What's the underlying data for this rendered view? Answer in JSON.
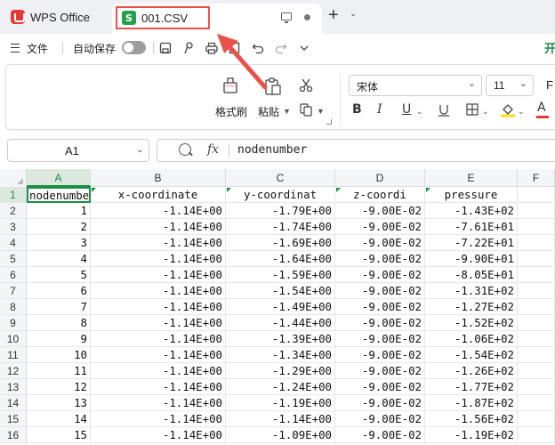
{
  "app": {
    "name": "WPS Office"
  },
  "tab": {
    "title": "001.CSV",
    "icon_letter": "S"
  },
  "toolbar": {
    "file_label": "文件",
    "autosave_label": "自动保存",
    "start_label": "开"
  },
  "ribbon": {
    "format_painter_label": "格式刷",
    "paste_label": "粘贴",
    "font_name": "宋体",
    "font_size": "11",
    "bold": "B",
    "italic": "I",
    "underline": "U",
    "font_color_letter": "A",
    "partial_letter": "F"
  },
  "formula_bar": {
    "cell_ref": "A1",
    "fx_label": "fx",
    "value": "nodenumber"
  },
  "colors": {
    "accent": "#1a8e45",
    "annotation": "#e9524a"
  },
  "grid": {
    "columns": [
      "A",
      "B",
      "C",
      "D",
      "E",
      "F"
    ],
    "header_row": {
      "row": "1",
      "cells": [
        "nodenumbe",
        "x-coordinate",
        "y-coordinat",
        "z-coordi",
        "pressure",
        ""
      ]
    },
    "rows": [
      {
        "row": "2",
        "cells": [
          "1",
          "-1.14E+00",
          "-1.79E+00",
          "-9.00E-02",
          "-1.43E+02",
          ""
        ]
      },
      {
        "row": "3",
        "cells": [
          "2",
          "-1.14E+00",
          "-1.74E+00",
          "-9.00E-02",
          "-7.61E+01",
          ""
        ]
      },
      {
        "row": "4",
        "cells": [
          "3",
          "-1.14E+00",
          "-1.69E+00",
          "-9.00E-02",
          "-7.22E+01",
          ""
        ]
      },
      {
        "row": "5",
        "cells": [
          "4",
          "-1.14E+00",
          "-1.64E+00",
          "-9.00E-02",
          "-9.90E+01",
          ""
        ]
      },
      {
        "row": "6",
        "cells": [
          "5",
          "-1.14E+00",
          "-1.59E+00",
          "-9.00E-02",
          "-8.05E+01",
          ""
        ]
      },
      {
        "row": "7",
        "cells": [
          "6",
          "-1.14E+00",
          "-1.54E+00",
          "-9.00E-02",
          "-1.31E+02",
          ""
        ]
      },
      {
        "row": "8",
        "cells": [
          "7",
          "-1.14E+00",
          "-1.49E+00",
          "-9.00E-02",
          "-1.27E+02",
          ""
        ]
      },
      {
        "row": "9",
        "cells": [
          "8",
          "-1.14E+00",
          "-1.44E+00",
          "-9.00E-02",
          "-1.52E+02",
          ""
        ]
      },
      {
        "row": "10",
        "cells": [
          "9",
          "-1.14E+00",
          "-1.39E+00",
          "-9.00E-02",
          "-1.06E+02",
          ""
        ]
      },
      {
        "row": "11",
        "cells": [
          "10",
          "-1.14E+00",
          "-1.34E+00",
          "-9.00E-02",
          "-1.54E+02",
          ""
        ]
      },
      {
        "row": "12",
        "cells": [
          "11",
          "-1.14E+00",
          "-1.29E+00",
          "-9.00E-02",
          "-1.26E+02",
          ""
        ]
      },
      {
        "row": "13",
        "cells": [
          "12",
          "-1.14E+00",
          "-1.24E+00",
          "-9.00E-02",
          "-1.77E+02",
          ""
        ]
      },
      {
        "row": "14",
        "cells": [
          "13",
          "-1.14E+00",
          "-1.19E+00",
          "-9.00E-02",
          "-1.87E+02",
          ""
        ]
      },
      {
        "row": "15",
        "cells": [
          "14",
          "-1.14E+00",
          "-1.14E+00",
          "-9.00E-02",
          "-1.56E+02",
          ""
        ]
      },
      {
        "row": "16",
        "cells": [
          "15",
          "-1.14E+00",
          "-1.09E+00",
          "-9.00E-02",
          "-1.19E+02",
          ""
        ]
      }
    ]
  }
}
